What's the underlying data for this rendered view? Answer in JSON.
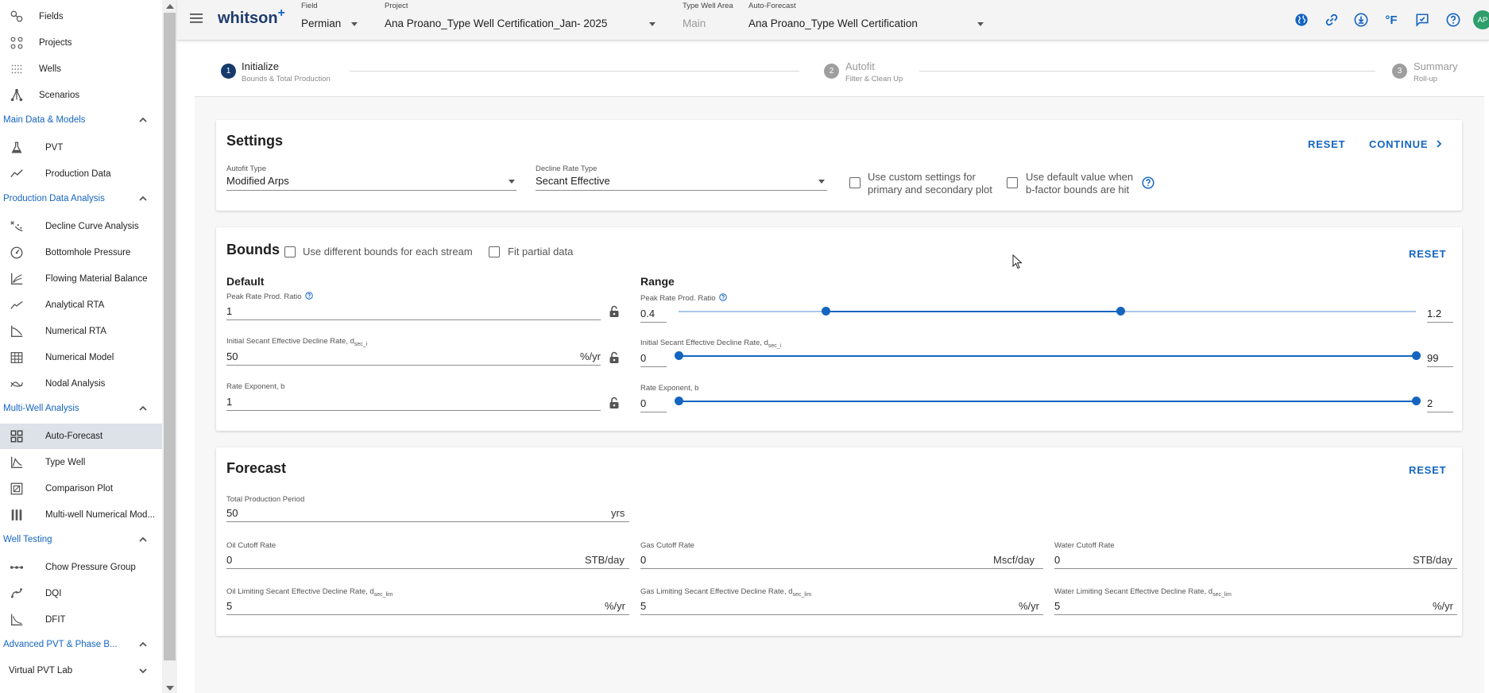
{
  "sidebar": {
    "top_items": [
      {
        "label": "Fields",
        "icon": "fields-icon"
      },
      {
        "label": "Projects",
        "icon": "projects-icon"
      },
      {
        "label": "Wells",
        "icon": "wells-icon"
      },
      {
        "label": "Scenarios",
        "icon": "scenarios-icon"
      }
    ],
    "sections": [
      {
        "label": "Main Data & Models",
        "items": [
          {
            "label": "PVT",
            "icon": "flask-icon"
          },
          {
            "label": "Production Data",
            "icon": "trend-icon"
          }
        ]
      },
      {
        "label": "Production Data Analysis",
        "items": [
          {
            "label": "Decline Curve Analysis",
            "icon": "decline-curve-icon"
          },
          {
            "label": "Bottomhole Pressure",
            "icon": "gauge-icon"
          },
          {
            "label": "Flowing Material Balance",
            "icon": "fmb-chart-icon"
          },
          {
            "label": "Analytical RTA",
            "icon": "analytical-rta-icon"
          },
          {
            "label": "Numerical RTA",
            "icon": "numerical-rta-icon"
          },
          {
            "label": "Numerical Model",
            "icon": "grid-model-icon"
          },
          {
            "label": "Nodal Analysis",
            "icon": "nodal-icon"
          }
        ]
      },
      {
        "label": "Multi-Well Analysis",
        "items": [
          {
            "label": "Auto-Forecast",
            "icon": "dashboard-grid-icon",
            "active": true
          },
          {
            "label": "Type Well",
            "icon": "type-well-icon"
          },
          {
            "label": "Comparison Plot",
            "icon": "comparison-icon"
          },
          {
            "label": "Multi-well Numerical Mod...",
            "icon": "columns-icon"
          }
        ]
      },
      {
        "label": "Well Testing",
        "items": [
          {
            "label": "Chow Pressure Group",
            "icon": "dots-line-icon"
          },
          {
            "label": "DQI",
            "icon": "dqi-icon"
          },
          {
            "label": "DFIT",
            "icon": "dfit-icon"
          }
        ]
      },
      {
        "label": "Advanced PVT & Phase B...",
        "items": []
      }
    ],
    "last_section": "Virtual PVT Lab"
  },
  "topbar": {
    "logo": "whitson",
    "logo_plus": "+",
    "field_label": "Field",
    "field_value": "Permian",
    "project_label": "Project",
    "project_value": "Ana Proano_Type Well Certification_Jan- 2025",
    "area_label": "Type Well Area",
    "area_value": "Main",
    "autoforecast_label": "Auto-Forecast",
    "autoforecast_value": "Ana Proano_Type Well Certification",
    "unit_text": "°F",
    "avatar_initials": "AP",
    "accent": "#1565c0",
    "avatar_color": "#2e9e6b"
  },
  "stepper": {
    "steps": [
      {
        "num": "1",
        "title": "Initialize",
        "sub": "Bounds & Total Production",
        "active": true
      },
      {
        "num": "2",
        "title": "Autofit",
        "sub": "Filter & Clean Up"
      },
      {
        "num": "3",
        "title": "Summary",
        "sub": "Roll-up"
      }
    ]
  },
  "settings": {
    "title": "Settings",
    "reset": "RESET",
    "continue": "CONTINUE",
    "autofit_type_label": "Autofit Type",
    "autofit_type_value": "Modified Arps",
    "decline_rate_label": "Decline Rate Type",
    "decline_rate_value": "Secant Effective",
    "custom_settings_line1": "Use custom settings for",
    "custom_settings_line2": "primary and secondary plot",
    "default_value_line1": "Use default value when",
    "default_value_line2": "b-factor bounds are hit"
  },
  "bounds": {
    "title": "Bounds",
    "diff_bounds_label": "Use different bounds for each stream",
    "fit_partial_label": "Fit partial data",
    "reset": "RESET",
    "default_title": "Default",
    "range_title": "Range",
    "peak_label": "Peak Rate Prod. Ratio",
    "peak_value": "1",
    "decline_label": "Initial Secant Effective Decline Rate, d",
    "decline_sub": "sec_i",
    "decline_value": "50",
    "decline_unit": "%/yr",
    "exponent_label": "Rate Exponent, b",
    "exponent_value": "1",
    "range_peak_label": "Peak Rate Prod. Ratio",
    "range_peak_min": "0.4",
    "range_peak_max": "1.2",
    "range_peak_low_frac": 0.2,
    "range_peak_high_frac": 0.6,
    "range_decline_label": "Initial Secant Effective Decline Rate, d",
    "range_decline_sub": "sec_i",
    "range_decline_min": "0",
    "range_decline_max": "99",
    "range_exp_label": "Rate Exponent, b",
    "range_exp_min": "0",
    "range_exp_max": "2"
  },
  "forecast": {
    "title": "Forecast",
    "reset": "RESET",
    "total_period_label": "Total Production Period",
    "total_period_value": "50",
    "total_period_unit": "yrs",
    "oil_cutoff_label": "Oil Cutoff Rate",
    "oil_cutoff_value": "0",
    "oil_cutoff_unit": "STB/day",
    "gas_cutoff_label": "Gas Cutoff Rate",
    "gas_cutoff_value": "0",
    "gas_cutoff_unit": "Mscf/day",
    "water_cutoff_label": "Water Cutoff Rate",
    "water_cutoff_value": "0",
    "water_cutoff_unit": "STB/day",
    "oil_lim_label": "Oil Limiting Secant Effective Decline Rate, d",
    "gas_lim_label": "Gas Limiting Secant Effective Decline Rate, d",
    "water_lim_label": "Water Limiting Secant Effective Decline Rate, d",
    "lim_sub": "sec_lim",
    "oil_lim_value": "5",
    "gas_lim_value": "5",
    "water_lim_value": "5",
    "lim_unit": "%/yr"
  }
}
